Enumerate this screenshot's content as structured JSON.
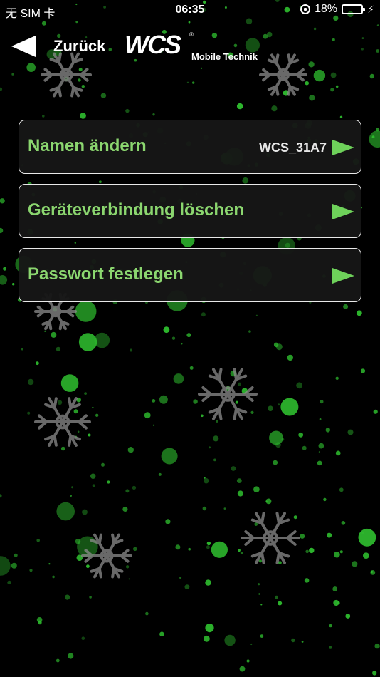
{
  "status_bar": {
    "carrier": "无 SIM 卡",
    "time": "06:35",
    "battery_percent": "18%",
    "battery_level": 0.18,
    "battery_color": "#ff3b30"
  },
  "nav": {
    "back_label": "Zurück",
    "logo_text": "WCS",
    "logo_registered": "®",
    "logo_subtitle": "Mobile Technik"
  },
  "menu": {
    "items": [
      {
        "label": "Namen ändern",
        "value": "WCS_31A7",
        "icon": "play-arrow-icon"
      },
      {
        "label": "Geräteverbindung löschen",
        "value": "",
        "icon": "play-arrow-icon"
      },
      {
        "label": "Passwort festlegen",
        "value": "",
        "icon": "play-arrow-icon"
      }
    ]
  },
  "theme": {
    "accent": "#8bd66f",
    "arrow": "#6ed15a",
    "background": "#000000",
    "dots": "#2fbf2f",
    "snowflake": "#8c8c8c"
  }
}
